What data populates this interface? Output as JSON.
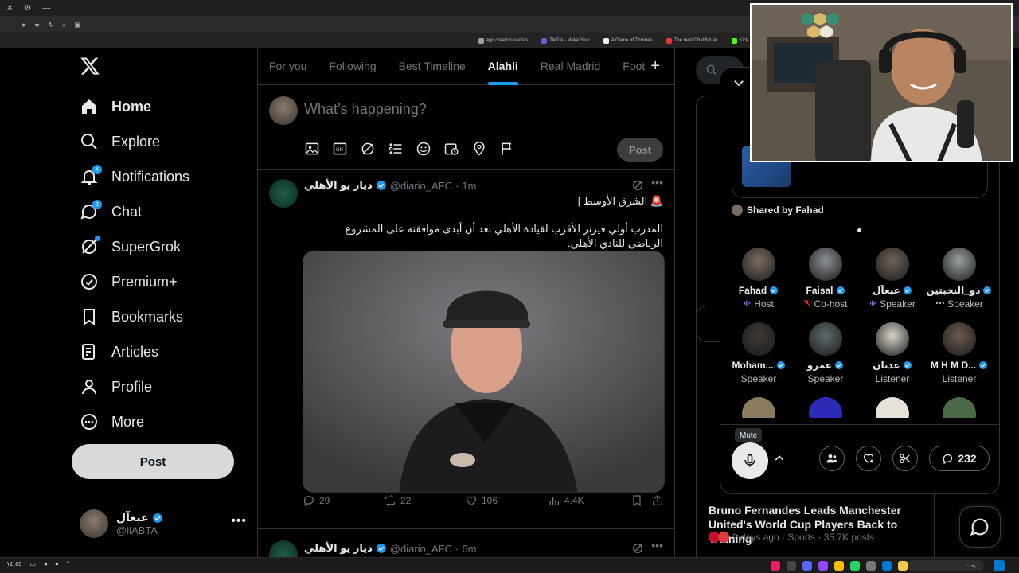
{
  "browser": {
    "bookmarks": [
      {
        "label": "app.creators.sa/das...",
        "color": "#9aa0a6"
      },
      {
        "label": "TikTok - Make Your...",
        "color": "#6b5bd6"
      },
      {
        "label": "A Game of Thrones...",
        "color": "#eeeeee"
      },
      {
        "label": "The best ChatBot an...",
        "color": "#e53935"
      },
      {
        "label": "Kick",
        "color": "#53fc18"
      }
    ]
  },
  "sidebar": {
    "items": [
      {
        "label": "Home",
        "icon": "home-icon",
        "active": true,
        "badge": ""
      },
      {
        "label": "Explore",
        "icon": "search-icon",
        "active": false,
        "badge": ""
      },
      {
        "label": "Notifications",
        "icon": "bell-icon",
        "active": false,
        "badge": "4"
      },
      {
        "label": "Chat",
        "icon": "chat-icon",
        "active": false,
        "badge": "2"
      },
      {
        "label": "SuperGrok",
        "icon": "grok-icon",
        "active": false,
        "badge": ""
      },
      {
        "label": "Premium+",
        "icon": "verified-icon",
        "active": false,
        "badge": ""
      },
      {
        "label": "Bookmarks",
        "icon": "bookmark-icon",
        "active": false,
        "badge": ""
      },
      {
        "label": "Articles",
        "icon": "article-icon",
        "active": false,
        "badge": ""
      },
      {
        "label": "Profile",
        "icon": "person-icon",
        "active": false,
        "badge": ""
      },
      {
        "label": "More",
        "icon": "more-circle-icon",
        "active": false,
        "badge": ""
      }
    ],
    "post_label": "Post",
    "account": {
      "name": "عبعآل",
      "handle": "@iiABTA"
    }
  },
  "tabs": [
    "For you",
    "Following",
    "Best Timeline",
    "Alahli",
    "Real Madrid",
    "Foot"
  ],
  "active_tab": "Alahli",
  "composer": {
    "placeholder": "What’s happening?",
    "post_label": "Post"
  },
  "tweets": [
    {
      "name": "ديار يو الأهلي",
      "handle": "@diario_AFC",
      "time": "1m",
      "line1": "🚨 الشرق الأوسط |",
      "text": "المدرب أولي فيرنر الأقرب لقيادة الأهلي بعد أن أبدى موافقته على المشروع الرياضي للنادي الأهلي.",
      "replies": "29",
      "reposts": "22",
      "likes": "106",
      "views": "4.4K"
    },
    {
      "name": "ديار يو الأهلي",
      "handle": "@diario_AFC",
      "time": "6m"
    }
  ],
  "right": {
    "news_title": "Bruno Fernandes Leads Manchester United's World Cup Players Back to Training",
    "news_meta": "2 days ago · Sports · 35.7K posts"
  },
  "space": {
    "shared_by": "Shared by Fahad",
    "participants": [
      {
        "name": "Fahad",
        "role": "Host",
        "role_icon": "bars-icon",
        "color": "#7a6c60"
      },
      {
        "name": "Faisal",
        "role": "Co-host",
        "role_icon": "mic-off-icon",
        "color": "#8b8f94"
      },
      {
        "name": "عبعآل",
        "role": "Speaker",
        "role_icon": "bars-icon",
        "color": "#6e6258"
      },
      {
        "name": "ذو_النخبتين",
        "role": "Speaker",
        "role_icon": "dots-icon",
        "color": "#9aa19c"
      },
      {
        "name": "Moham...",
        "role": "Speaker",
        "role_icon": "",
        "color": "#3e3a36"
      },
      {
        "name": "عمرو",
        "role": "Speaker",
        "role_icon": "",
        "color": "#5e6a6e"
      },
      {
        "name": "عدنان",
        "role": "Listener",
        "role_icon": "",
        "color": "#d8d4cc"
      },
      {
        "name": "M H M D...",
        "role": "Listener",
        "role_icon": "",
        "color": "#6c5a50"
      }
    ],
    "mute_tooltip": "Mute",
    "comments_count": "232"
  },
  "taskbar": {
    "search_placeholder": "بحث"
  }
}
